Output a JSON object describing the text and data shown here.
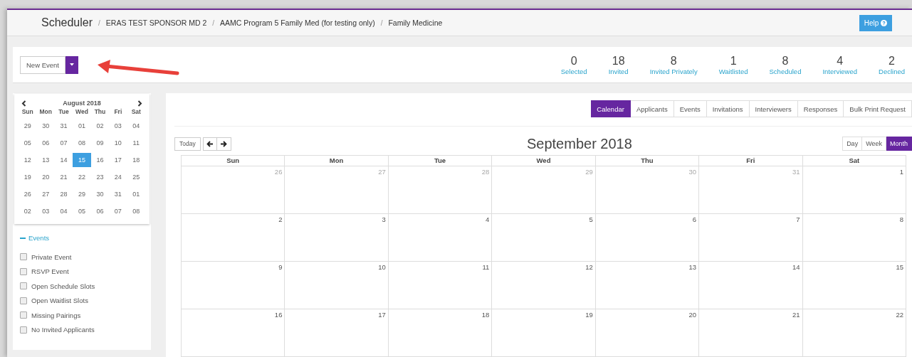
{
  "header": {
    "title": "Scheduler",
    "breadcrumbs": [
      "ERAS TEST SPONSOR MD 2",
      "AAMC Program 5 Family Med (for testing only)",
      "Family Medicine"
    ],
    "separator": "/",
    "help": "Help"
  },
  "toolbar": {
    "new_event": "New Event"
  },
  "stats": [
    {
      "count": "0",
      "label": "Selected"
    },
    {
      "count": "18",
      "label": "Invited"
    },
    {
      "count": "8",
      "label": "Invited Privately"
    },
    {
      "count": "1",
      "label": "Waitlisted"
    },
    {
      "count": "8",
      "label": "Scheduled"
    },
    {
      "count": "4",
      "label": "Interviewed"
    },
    {
      "count": "2",
      "label": "Declined"
    }
  ],
  "mini_calendar": {
    "title": "August 2018",
    "weekdays": [
      "Sun",
      "Mon",
      "Tue",
      "Wed",
      "Thu",
      "Fri",
      "Sat"
    ],
    "weeks": [
      [
        {
          "day": "29",
          "selected": false
        },
        {
          "day": "30",
          "selected": false
        },
        {
          "day": "31",
          "selected": false
        },
        {
          "day": "01",
          "selected": false
        },
        {
          "day": "02",
          "selected": false
        },
        {
          "day": "03",
          "selected": false
        },
        {
          "day": "04",
          "selected": false
        }
      ],
      [
        {
          "day": "05",
          "selected": false
        },
        {
          "day": "06",
          "selected": false
        },
        {
          "day": "07",
          "selected": false
        },
        {
          "day": "08",
          "selected": false
        },
        {
          "day": "09",
          "selected": false
        },
        {
          "day": "10",
          "selected": false
        },
        {
          "day": "11",
          "selected": false
        }
      ],
      [
        {
          "day": "12",
          "selected": false
        },
        {
          "day": "13",
          "selected": false
        },
        {
          "day": "14",
          "selected": false
        },
        {
          "day": "15",
          "selected": true
        },
        {
          "day": "16",
          "selected": false
        },
        {
          "day": "17",
          "selected": false
        },
        {
          "day": "18",
          "selected": false
        }
      ],
      [
        {
          "day": "19",
          "selected": false
        },
        {
          "day": "20",
          "selected": false
        },
        {
          "day": "21",
          "selected": false
        },
        {
          "day": "22",
          "selected": false
        },
        {
          "day": "23",
          "selected": false
        },
        {
          "day": "24",
          "selected": false
        },
        {
          "day": "25",
          "selected": false
        }
      ],
      [
        {
          "day": "26",
          "selected": false
        },
        {
          "day": "27",
          "selected": false
        },
        {
          "day": "28",
          "selected": false
        },
        {
          "day": "29",
          "selected": false
        },
        {
          "day": "30",
          "selected": false
        },
        {
          "day": "31",
          "selected": false
        },
        {
          "day": "01",
          "selected": false
        }
      ],
      [
        {
          "day": "02",
          "selected": false
        },
        {
          "day": "03",
          "selected": false
        },
        {
          "day": "04",
          "selected": false
        },
        {
          "day": "05",
          "selected": false
        },
        {
          "day": "06",
          "selected": false
        },
        {
          "day": "07",
          "selected": false
        },
        {
          "day": "08",
          "selected": false
        }
      ]
    ]
  },
  "events_filter": {
    "title": "Events",
    "expanded": true,
    "items": [
      {
        "label": "Private Event",
        "checked": false
      },
      {
        "label": "RSVP Event",
        "checked": false
      },
      {
        "label": "Open Schedule Slots",
        "checked": false
      },
      {
        "label": "Open Waitlist Slots",
        "checked": false
      },
      {
        "label": "Missing Pairings",
        "checked": false
      },
      {
        "label": "No Invited Applicants",
        "checked": false
      }
    ]
  },
  "tabs": [
    {
      "label": "Calendar",
      "selected": true
    },
    {
      "label": "Applicants",
      "selected": false
    },
    {
      "label": "Events",
      "selected": false
    },
    {
      "label": "Invitations",
      "selected": false
    },
    {
      "label": "Interviewers",
      "selected": false
    },
    {
      "label": "Responses",
      "selected": false
    },
    {
      "label": "Bulk Print Request",
      "selected": false
    }
  ],
  "calendar": {
    "today": "Today",
    "title": "September 2018",
    "views": [
      {
        "label": "Day",
        "selected": false
      },
      {
        "label": "Week",
        "selected": false
      },
      {
        "label": "Month",
        "selected": true
      }
    ],
    "weekdays": [
      "Sun",
      "Mon",
      "Tue",
      "Wed",
      "Thu",
      "Fri",
      "Sat"
    ],
    "weeks": [
      [
        {
          "day": "26",
          "other_month": true
        },
        {
          "day": "27",
          "other_month": true
        },
        {
          "day": "28",
          "other_month": true
        },
        {
          "day": "29",
          "other_month": true
        },
        {
          "day": "30",
          "other_month": true
        },
        {
          "day": "31",
          "other_month": true
        },
        {
          "day": "1",
          "other_month": false
        }
      ],
      [
        {
          "day": "2",
          "other_month": false
        },
        {
          "day": "3",
          "other_month": false
        },
        {
          "day": "4",
          "other_month": false
        },
        {
          "day": "5",
          "other_month": false
        },
        {
          "day": "6",
          "other_month": false
        },
        {
          "day": "7",
          "other_month": false
        },
        {
          "day": "8",
          "other_month": false
        }
      ],
      [
        {
          "day": "9",
          "other_month": false
        },
        {
          "day": "10",
          "other_month": false
        },
        {
          "day": "11",
          "other_month": false
        },
        {
          "day": "12",
          "other_month": false
        },
        {
          "day": "13",
          "other_month": false
        },
        {
          "day": "14",
          "other_month": false
        },
        {
          "day": "15",
          "other_month": false
        }
      ],
      [
        {
          "day": "16",
          "other_month": false
        },
        {
          "day": "17",
          "other_month": false
        },
        {
          "day": "18",
          "other_month": false
        },
        {
          "day": "19",
          "other_month": false
        },
        {
          "day": "20",
          "other_month": false
        },
        {
          "day": "21",
          "other_month": false
        },
        {
          "day": "22",
          "other_month": false
        }
      ]
    ]
  }
}
